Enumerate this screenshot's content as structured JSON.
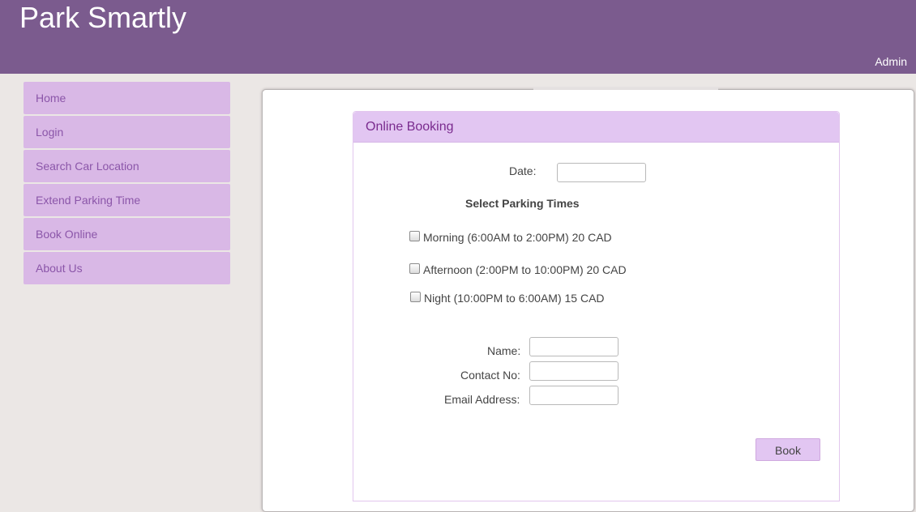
{
  "header": {
    "title": "Park Smartly",
    "user_link": "Admin"
  },
  "nav": {
    "items": [
      {
        "label": "Home"
      },
      {
        "label": "Login"
      },
      {
        "label": "Search Car Location"
      },
      {
        "label": "Extend Parking Time"
      },
      {
        "label": "Book Online"
      },
      {
        "label": "About Us"
      }
    ]
  },
  "booking": {
    "heading": "Online Booking",
    "date_label": "Date:",
    "date_value": "",
    "times_heading": "Select Parking Times",
    "options": [
      {
        "label": "Morning (6:00AM to 2:00PM) 20 CAD",
        "checked": false
      },
      {
        "label": "Afternoon (2:00PM to 10:00PM) 20 CAD",
        "checked": false
      },
      {
        "label": "Night (10:00PM to 6:00AM) 15 CAD",
        "checked": false
      }
    ],
    "name_label": "Name:",
    "name_value": "",
    "contact_label": "Contact No:",
    "contact_value": "",
    "email_label": "Email Address:",
    "email_value": "",
    "submit_label": "Book"
  },
  "colors": {
    "header_bg": "#7b5b8e",
    "nav_item_bg": "#d9b8e6",
    "nav_text": "#8b56a9",
    "panel_head_bg": "#e2c6f2",
    "panel_head_text": "#7a2b8e",
    "page_bg": "#ebe7e5"
  }
}
